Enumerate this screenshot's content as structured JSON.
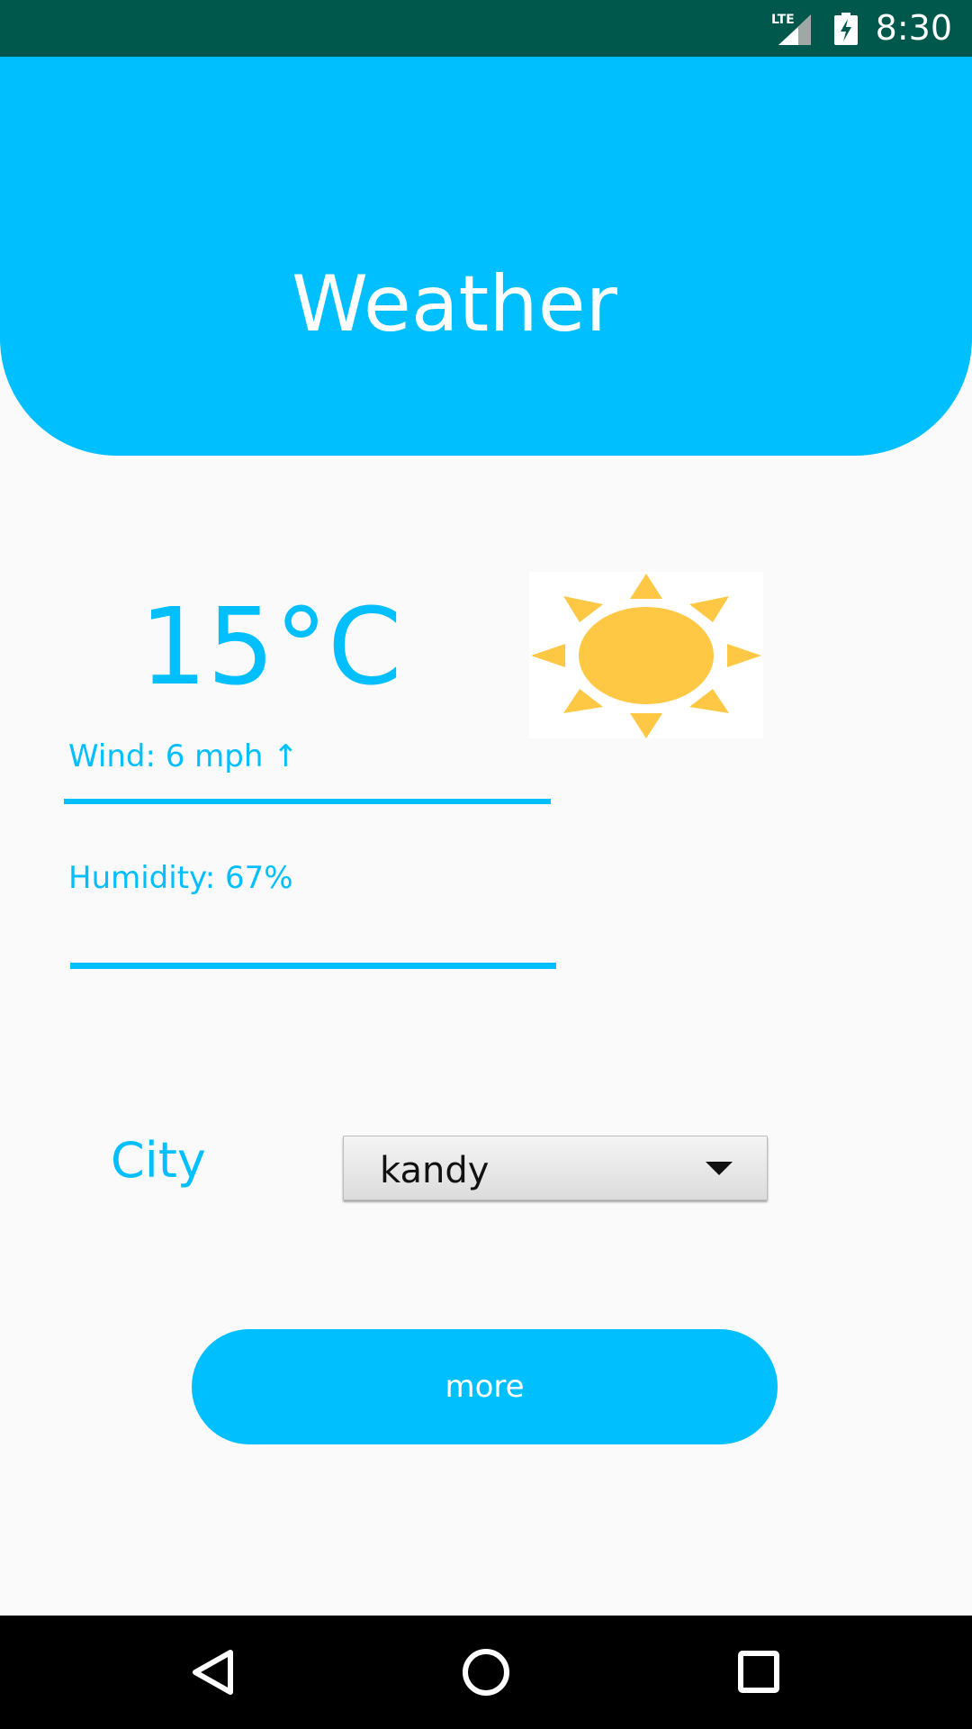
{
  "status_bar": {
    "network": "LTE",
    "time": "8:30",
    "icons": [
      "lte-signal-icon",
      "battery-charging-icon"
    ]
  },
  "header": {
    "title": "Weather"
  },
  "weather": {
    "temperature": "15°C",
    "condition_icon": "sun-icon",
    "wind": "Wind: 6 mph ↑",
    "humidity": "Humidity: 67%"
  },
  "city": {
    "label": "City",
    "selected": "kandy"
  },
  "actions": {
    "more_label": "more"
  },
  "nav_bar": {
    "icons": [
      "back-icon",
      "home-icon",
      "recents-icon"
    ]
  },
  "colors": {
    "accent": "#00bfff",
    "status_bar": "#00574b",
    "sun": "#ffc844",
    "background": "#fafafa"
  }
}
